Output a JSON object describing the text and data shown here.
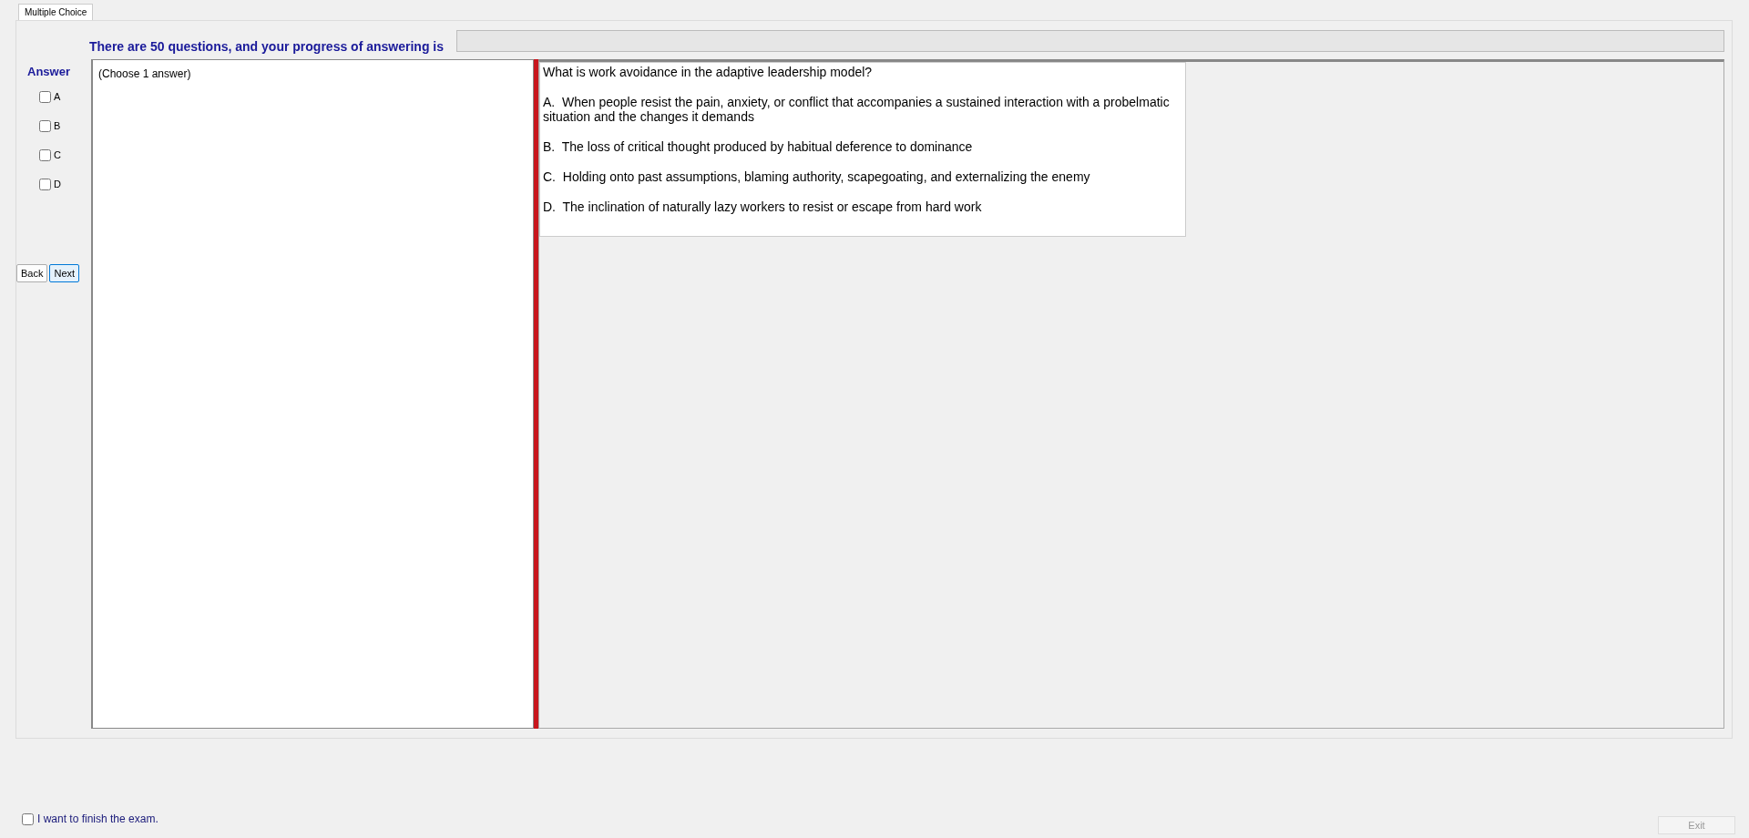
{
  "tabs": [
    {
      "label": "Multiple Choice",
      "selected": true
    }
  ],
  "progress": {
    "label": "There are 50 questions, and your progress of answering is",
    "level": 0
  },
  "answer": {
    "title": "Answer",
    "options": [
      {
        "label": "A",
        "checked": false
      },
      {
        "label": "B",
        "checked": false
      },
      {
        "label": "C",
        "checked": false
      },
      {
        "label": "D",
        "checked": false
      }
    ]
  },
  "buttons": [
    {
      "label": "Back",
      "selected": false
    },
    {
      "label": "Next",
      "selected": true
    }
  ],
  "hint": "(Choose 1 answer)",
  "question": {
    "text": "What is work avoidance in the adaptive leadership model?",
    "choices": [
      "A.  When people resist the pain, anxiety, or conflict that accompanies a sustained interaction with a probelmatic situation and the changes it demands",
      "B.  The loss of critical thought produced by habitual deference to dominance",
      "C.  Holding onto past assumptions, blaming authority, scapegoating, and externalizing the enemy",
      "D.  The inclination of naturally lazy workers to resist or escape from hard work"
    ]
  },
  "finish": {
    "label": "I want to finish the exam.",
    "checked": false
  },
  "exit": {
    "label": "Exit",
    "disabled": true
  }
}
